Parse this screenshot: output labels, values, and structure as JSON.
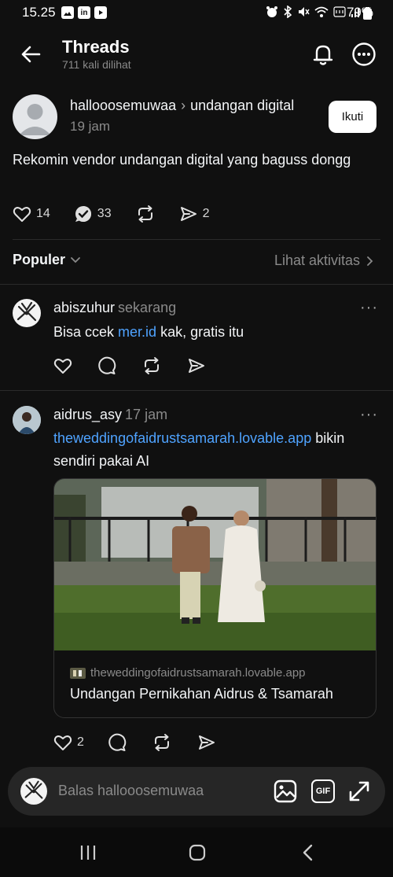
{
  "status_bar": {
    "time": "15.25",
    "battery": "79%",
    "icons_left": [
      "gallery-icon",
      "linkedin-icon",
      "youtube-icon"
    ],
    "icons_right": [
      "alarm-icon",
      "bluetooth-icon",
      "mute-icon",
      "wifi-icon",
      "volte-icon",
      "signal-icon",
      "battery-icon"
    ],
    "linkedin_label": "in"
  },
  "header": {
    "title": "Threads",
    "views": "711 kali dilihat"
  },
  "post": {
    "username": "hallooosemuwaa",
    "topic": "undangan digital",
    "time": "19 jam",
    "follow_label": "Ikuti",
    "text": "Rekomin vendor undangan digital yang baguss dongg",
    "likes": "14",
    "replies": "33",
    "shares": "2"
  },
  "filter": {
    "sort_label": "Populer",
    "activity_label": "Lihat aktivitas"
  },
  "replies": [
    {
      "username": "abiszuhur",
      "time": "sekarang",
      "text_before": "Bisa ccek ",
      "link": "mer.id",
      "text_after": " kak, gratis itu"
    },
    {
      "username": "aidrus_asy",
      "time": "17 jam",
      "link": "theweddingofaidrustsamarah.lovable.app",
      "text_after": " bikin sendiri pakai AI",
      "card_domain": "theweddingofaidrustsamarah.lovable.app",
      "card_title": "Undangan Pernikahan Aidrus & Tsamarah",
      "likes": "2"
    }
  ],
  "reply_bar": {
    "placeholder": "Balas hallooosemuwaa",
    "gif_label": "GIF"
  },
  "colors": {
    "background": "#101010",
    "link": "#4fa3ff",
    "muted": "#8a8a8a"
  }
}
